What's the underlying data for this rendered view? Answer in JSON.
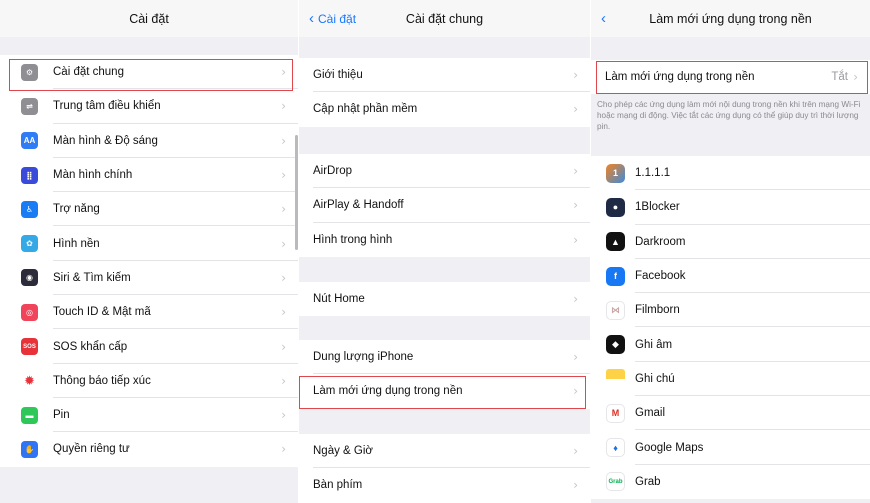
{
  "panel_general": {
    "title": "Cài đặt",
    "items": [
      {
        "label": "Cài đặt chung",
        "icon": "gear-icon",
        "color": "#8e8e93",
        "glyph": "⚙"
      },
      {
        "label": "Trung tâm điều khiển",
        "icon": "control-center-icon",
        "color": "#8e8e93",
        "glyph": "⇌"
      },
      {
        "label": "Màn hình & Độ sáng",
        "icon": "display-brightness-icon",
        "color": "#2f7cf6",
        "glyph": "AA"
      },
      {
        "label": "Màn hình chính",
        "icon": "home-screen-icon",
        "color": "#3a4bd9",
        "glyph": "⣿"
      },
      {
        "label": "Trợ năng",
        "icon": "accessibility-icon",
        "color": "#1a7cf5",
        "glyph": "♿"
      },
      {
        "label": "Hình nền",
        "icon": "wallpaper-icon",
        "color": "#35a8e6",
        "glyph": "✿"
      },
      {
        "label": "Siri & Tìm kiếm",
        "icon": "siri-icon",
        "color": "#2b2b3a",
        "glyph": "◉"
      },
      {
        "label": "Touch ID & Mật mã",
        "icon": "fingerprint-icon",
        "color": "#f0445b",
        "glyph": "◎"
      },
      {
        "label": "SOS khẩn cấp",
        "icon": "sos-icon",
        "color": "#e8323a",
        "glyph": "SOS"
      },
      {
        "label": "Thông báo tiếp xúc",
        "icon": "exposure-notification-icon",
        "color": "#ffffff",
        "glyph": "✹"
      },
      {
        "label": "Pin",
        "icon": "battery-icon",
        "color": "#30c75a",
        "glyph": "▬"
      },
      {
        "label": "Quyền riêng tư",
        "icon": "privacy-hand-icon",
        "color": "#2f74f2",
        "glyph": "✋"
      }
    ]
  },
  "panel_general_detail": {
    "back_label": "Cài đặt",
    "title": "Cài đặt chung",
    "group1": [
      "Giới thiệu",
      "Cập nhật phần mềm"
    ],
    "group2": [
      "AirDrop",
      "AirPlay & Handoff",
      "Hình trong hình"
    ],
    "group3": [
      "Nút Home"
    ],
    "group4": [
      "Dung lượng iPhone",
      "Làm mới ứng dụng trong nền"
    ],
    "group5": [
      "Ngày & Giờ",
      "Bàn phím"
    ]
  },
  "panel_refresh": {
    "title": "Làm mới ứng dụng trong nền",
    "top_row": {
      "label": "Làm mới ứng dụng trong nền",
      "value": "Tắt"
    },
    "description": "Cho phép các ứng dụng làm mới nội dung trong nền khi trên mạng Wi-Fi hoặc mạng di động. Việc tắt các ứng dụng có thể giúp duy trì thời lượng pin.",
    "apps": [
      {
        "label": "1.1.1.1",
        "icon": "app-1111-icon",
        "color": "#f48220",
        "glyph": "1"
      },
      {
        "label": "1Blocker",
        "icon": "app-1blocker-icon",
        "color": "#1f2a44",
        "glyph": "●"
      },
      {
        "label": "Darkroom",
        "icon": "app-darkroom-icon",
        "color": "#111111",
        "glyph": "▲"
      },
      {
        "label": "Facebook",
        "icon": "app-facebook-icon",
        "color": "#1877f2",
        "glyph": "f"
      },
      {
        "label": "Filmborn",
        "icon": "app-filmborn-icon",
        "color": "#ffffff",
        "glyph": "⋈"
      },
      {
        "label": "Ghi âm",
        "icon": "app-voice-memos-icon",
        "color": "#111111",
        "glyph": "◆"
      },
      {
        "label": "Ghi chú",
        "icon": "app-notes-icon",
        "color": "#fdd247",
        "glyph": ""
      },
      {
        "label": "Gmail",
        "icon": "app-gmail-icon",
        "color": "#ffffff",
        "glyph": "M"
      },
      {
        "label": "Google Maps",
        "icon": "app-google-maps-icon",
        "color": "#ffffff",
        "glyph": "♦"
      },
      {
        "label": "Grab",
        "icon": "app-grab-icon",
        "color": "#ffffff",
        "glyph": "Grab"
      }
    ]
  },
  "accent_color": "#1677ff",
  "highlight_color": "#e0474c"
}
